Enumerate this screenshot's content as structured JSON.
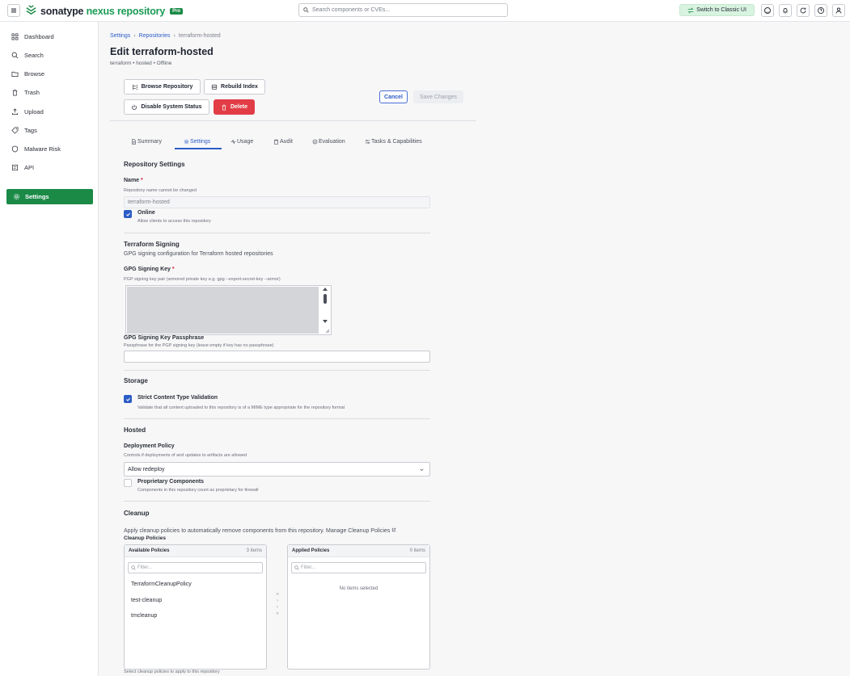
{
  "topbar": {
    "brand_main": "sonatype",
    "brand_product": "nexus repository",
    "brand_badge": "Pro",
    "search_placeholder": "Search components or CVEs...",
    "classic_ui_label": "Switch to Classic UI"
  },
  "sidebar": {
    "items": [
      {
        "label": "Dashboard",
        "icon": "grid-icon"
      },
      {
        "label": "Search",
        "icon": "search-icon"
      },
      {
        "label": "Browse",
        "icon": "folder-icon"
      },
      {
        "label": "Trash",
        "icon": "trash-icon"
      },
      {
        "label": "Upload",
        "icon": "upload-icon"
      },
      {
        "label": "Tags",
        "icon": "tag-icon"
      },
      {
        "label": "Malware Risk",
        "icon": "shield-icon"
      },
      {
        "label": "API",
        "icon": "api-icon"
      }
    ],
    "active": {
      "label": "Settings",
      "icon": "gear-icon"
    }
  },
  "breadcrumb": {
    "items": [
      "Settings",
      "Repositories",
      "terraform-hosted"
    ]
  },
  "page": {
    "title": "Edit terraform-hosted",
    "subtitle": "terraform • hosted • Offline"
  },
  "actions": {
    "browse": "Browse Repository",
    "rebuild": "Rebuild Index",
    "disable": "Disable System Status",
    "delete": "Delete",
    "cancel": "Cancel",
    "save": "Save Changes"
  },
  "tabs": [
    "Summary",
    "Settings",
    "Usage",
    "Audit",
    "Evaluation",
    "Tasks & Capabilities"
  ],
  "active_tab": "Settings",
  "repo_settings": {
    "heading": "Repository Settings",
    "name_label": "Name",
    "required_mark": "*",
    "name_help": "Repository name cannot be changed",
    "name_value": "terraform-hosted",
    "online_label": "Online",
    "online_help": "Allow clients to access this repository",
    "online_checked": true
  },
  "terraform_signing": {
    "heading": "Terraform Signing",
    "description": "GPG signing configuration for Terraform hosted repositories",
    "key_label": "GPG Signing Key",
    "key_help": "PGP signing key pair (armored private key e.g. gpg --export-secret-key --armor)",
    "passphrase_label": "GPG Signing Key Passphrase",
    "passphrase_help": "Passphrase for the PGP signing key (leave empty if key has no passphrase)",
    "passphrase_value": ""
  },
  "storage": {
    "heading": "Storage",
    "strict_label": "Strict Content Type Validation",
    "strict_help": "Validate that all content uploaded to this repository is of a MIME type appropriate for the repository format",
    "strict_checked": true
  },
  "hosted": {
    "heading": "Hosted",
    "deployment_label": "Deployment Policy",
    "deployment_help": "Controls if deployments of and updates to artifacts are allowed",
    "deployment_value": "Allow redeploy",
    "proprietary_label": "Proprietary Components",
    "proprietary_help": "Components in this repository count as proprietary for firewall",
    "proprietary_checked": false
  },
  "cleanup": {
    "heading": "Cleanup",
    "description": "Apply cleanup policies to automatically remove components from this repository. Manage Cleanup Policies",
    "policies_label": "Cleanup Policies",
    "available": {
      "title": "Available Policies",
      "count": "3 items",
      "filter_placeholder": "Filter...",
      "items": [
        "TerraformCleanupPolicy",
        "test-cleanup",
        "tmcleanup"
      ]
    },
    "applied": {
      "title": "Applied Policies",
      "count": "0 items",
      "filter_placeholder": "Filter...",
      "empty": "No items selected"
    },
    "transfer_arrows": [
      "»",
      "›",
      "‹",
      "«"
    ],
    "footer_help": "Select cleanup policies to apply to this repository"
  }
}
